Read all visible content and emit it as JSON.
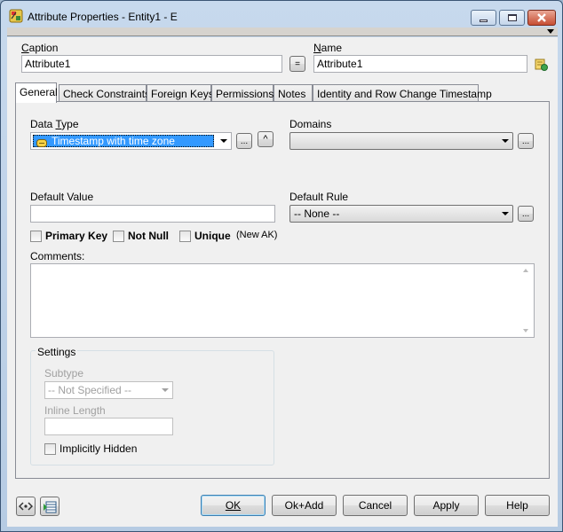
{
  "window": {
    "title": "Attribute Properties - Entity1 - E",
    "icon": "attribute-properties-icon"
  },
  "header": {
    "caption_label": "Caption",
    "caption_value": "Attribute1",
    "equals_label": "=",
    "name_label": "Name",
    "name_value": "Attribute1"
  },
  "tabs": [
    {
      "label": "General",
      "active": true
    },
    {
      "label": "Check Constraints",
      "active": false
    },
    {
      "label": "Foreign Keys",
      "active": false
    },
    {
      "label": "Permissions",
      "active": false
    },
    {
      "label": "Notes",
      "active": false
    },
    {
      "label": "Identity and Row Change Timestamp",
      "active": false
    }
  ],
  "general": {
    "data_type_label": "Data Type",
    "data_type_value": "Timestamp with time zone",
    "ellipsis": "...",
    "caret": "^",
    "domains_label": "Domains",
    "domains_value": "",
    "default_value_label": "Default Value",
    "default_value": "",
    "default_rule_label": "Default Rule",
    "default_rule_value": "-- None --",
    "primary_key_label": "Primary Key",
    "not_null_label": "Not Null",
    "unique_label": "Unique",
    "new_ak_label": "(New AK)",
    "comments_label": "Comments:",
    "comments_value": ""
  },
  "settings": {
    "group_label": "Settings",
    "subtype_label": "Subtype",
    "subtype_value": "-- Not Specified --",
    "inline_length_label": "Inline Length",
    "inline_length_value": "",
    "implicitly_hidden_label": "Implicitly Hidden"
  },
  "footer": {
    "ok_label": "OK",
    "ok_add_label": "Ok+Add",
    "cancel_label": "Cancel",
    "apply_label": "Apply",
    "help_label": "Help"
  }
}
